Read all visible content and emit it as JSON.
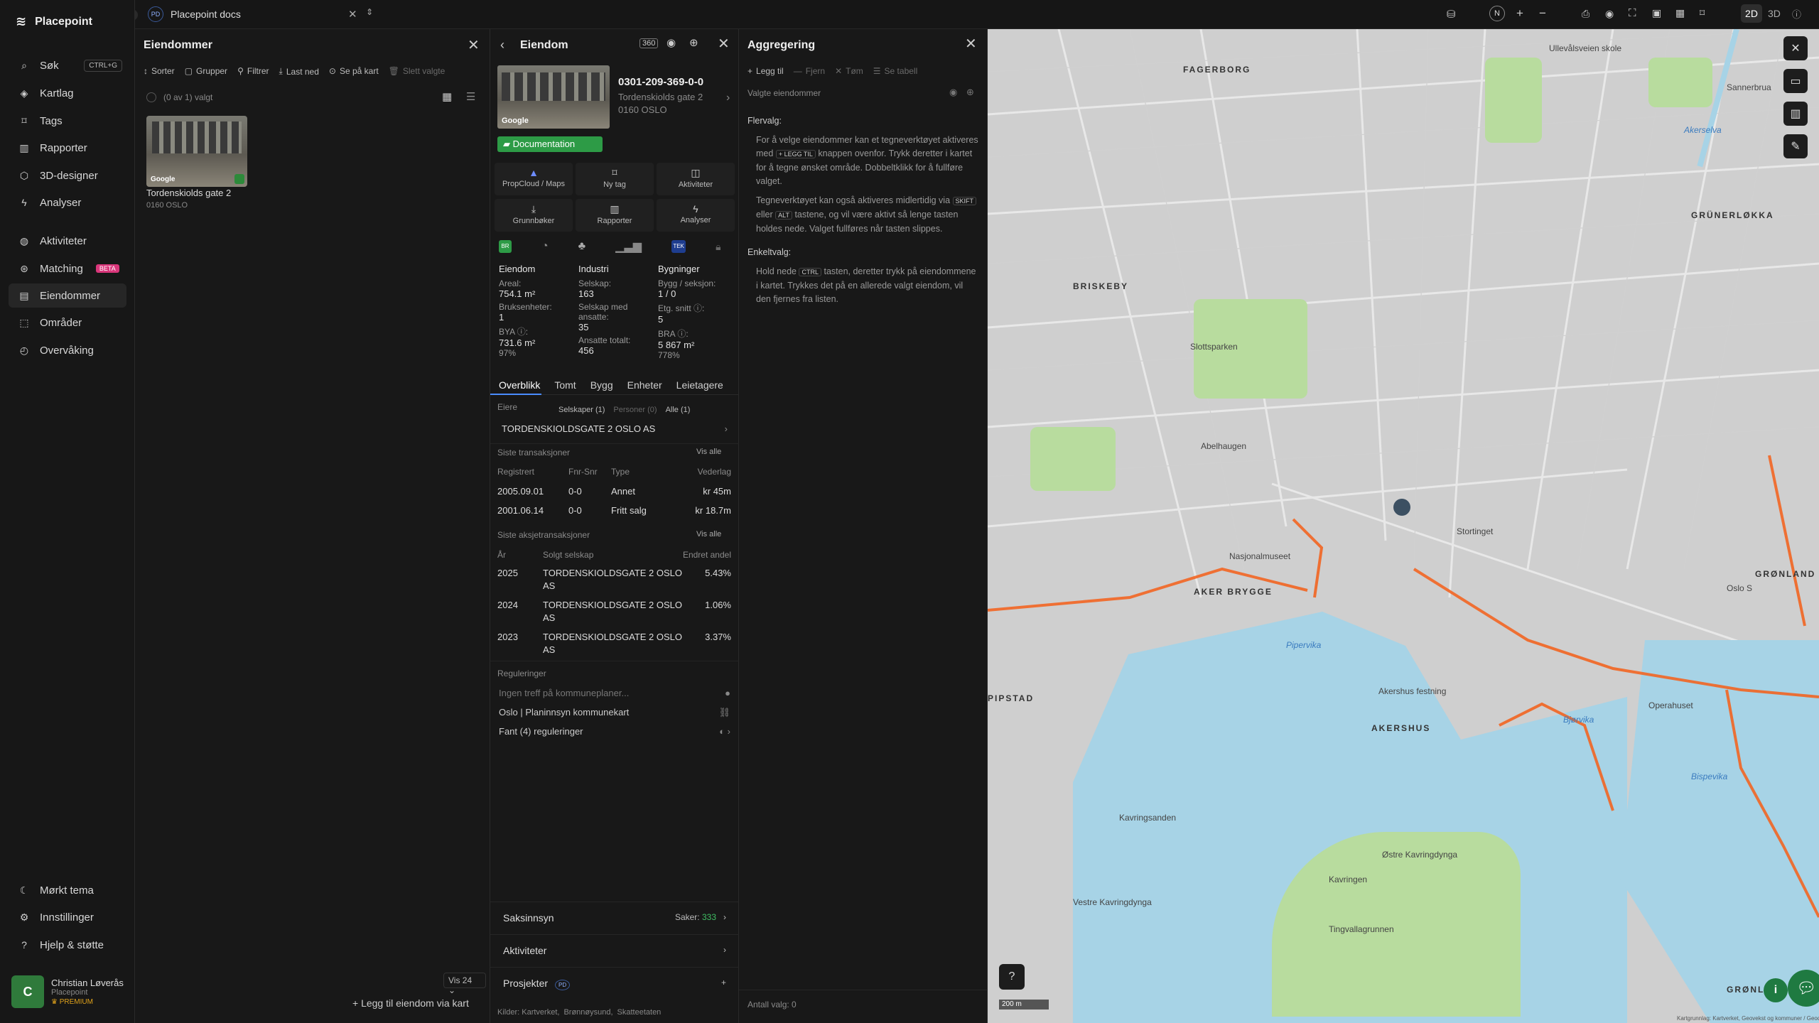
{
  "app": {
    "name": "Placepoint",
    "workspace_badge": "PD",
    "workspace": "Placepoint docs"
  },
  "nav": [
    {
      "label": "Søk",
      "icon": "search-icon",
      "kbd": "CTRL+G"
    },
    {
      "label": "Kartlag",
      "icon": "layers-icon"
    },
    {
      "label": "Tags",
      "icon": "bookmark-icon"
    },
    {
      "label": "Rapporter",
      "icon": "chart-icon"
    },
    {
      "label": "3D-designer",
      "icon": "cube-icon"
    },
    {
      "label": "Analyser",
      "icon": "bolt-icon"
    },
    {
      "label": "Aktiviteter",
      "icon": "activity-icon"
    },
    {
      "label": "Matching",
      "icon": "match-icon",
      "badge": "BETA"
    },
    {
      "label": "Eiendommer",
      "icon": "building-icon"
    },
    {
      "label": "Områder",
      "icon": "area-icon"
    },
    {
      "label": "Overvåking",
      "icon": "monitor-icon"
    }
  ],
  "bottom_nav": [
    {
      "label": "Mørkt tema",
      "icon": "moon-icon"
    },
    {
      "label": "Innstillinger",
      "icon": "gear-icon"
    },
    {
      "label": "Hjelp & støtte",
      "icon": "help-icon"
    }
  ],
  "user": {
    "initial": "C",
    "name": "Christian Løverås",
    "org": "Placepoint",
    "plan": "PREMIUM"
  },
  "topbar": {
    "view2d": "2D",
    "view3d": "3D",
    "north": "N"
  },
  "eiendommer": {
    "title": "Eiendommer",
    "tools": [
      "Sorter",
      "Grupper",
      "Filtrer",
      "Last ned",
      "Se på kart",
      "Slett valgte"
    ],
    "selected": "(0 av 1) valgt",
    "card_title": "Tordenskiolds gate 2",
    "card_sub": "0160 OSLO",
    "google": "Google",
    "vis": "Vis 24",
    "add": "Legg til eiendom via kart"
  },
  "eiendom": {
    "title": "Eiendom",
    "id": "0301-209-369-0-0",
    "addr1": "Tordenskiolds gate 2",
    "addr2": "0160 OSLO",
    "doc": "Documentation",
    "google": "Google",
    "actions": [
      "PropCloud / Maps",
      "Ny tag",
      "Aktiviteter",
      "Grunnbøker",
      "Rapporter",
      "Analyser"
    ],
    "cols": [
      {
        "h": "Eiendom",
        "items": [
          [
            "Areal:",
            "754.1 m²"
          ],
          [
            "Bruksenheter:",
            "1"
          ],
          [
            "BYA ⓘ:",
            "731.6 m²",
            "97%"
          ]
        ]
      },
      {
        "h": "Industri",
        "items": [
          [
            "Selskap:",
            "163"
          ],
          [
            "Selskap med ansatte:",
            "35"
          ],
          [
            "Ansatte totalt:",
            "456"
          ]
        ]
      },
      {
        "h": "Bygninger",
        "items": [
          [
            "Bygg / seksjon:",
            "1 / 0"
          ],
          [
            "Etg. snitt ⓘ:",
            "5"
          ],
          [
            "BRA ⓘ:",
            "5 867 m²",
            "778%"
          ]
        ]
      }
    ],
    "tabs": [
      "Overblikk",
      "Tomt",
      "Bygg",
      "Enheter",
      "Leietagere"
    ],
    "owners_label": "Eiere",
    "owners_filters": [
      "Selskaper (1)",
      "Personer (0)",
      "Alle (1)"
    ],
    "owner": "TORDENSKIOLDSGATE 2 OSLO AS",
    "trans_label": "Siste transaksjoner",
    "vis_alle": "Vis alle",
    "trans_cols": [
      "Registrert",
      "Fnr-Snr",
      "Type",
      "Vederlag"
    ],
    "trans": [
      [
        "2005.09.01",
        "0-0",
        "Annet",
        "kr 45m"
      ],
      [
        "2001.06.14",
        "0-0",
        "Fritt salg",
        "kr 18.7m"
      ]
    ],
    "share_label": "Siste aksjetransaksjoner",
    "share_cols": [
      "År",
      "Solgt selskap",
      "Endret andel"
    ],
    "shares": [
      [
        "2025",
        "TORDENSKIOLDSGATE 2 OSLO AS",
        "5.43%"
      ],
      [
        "2024",
        "TORDENSKIOLDSGATE 2 OSLO AS",
        "1.06%"
      ],
      [
        "2023",
        "TORDENSKIOLDSGATE 2 OSLO AS",
        "3.37%"
      ]
    ],
    "reg_label": "Reguleringer",
    "reg": [
      "Ingen treff på kommuneplaner...",
      "Oslo | Planinnsyn kommunekart",
      "Fant (4) reguleringer"
    ],
    "bottom": [
      {
        "label": "Saksinnsyn",
        "extra": "Saker:",
        "count": "333"
      },
      {
        "label": "Aktiviteter"
      },
      {
        "label": "Prosjekter",
        "badge": "PD"
      }
    ],
    "sources_label": "Kilder:",
    "sources": [
      "Kartverket,",
      "Brønnøysund,",
      "Skatteetaten"
    ]
  },
  "aggregering": {
    "title": "Aggregering",
    "tools": [
      "Legg til",
      "Fjern",
      "Tøm",
      "Se tabell"
    ],
    "sel": "Valgte eiendommer",
    "h1": "Flervalg:",
    "p1": "For å velge eiendommer kan et tegneverktøyet aktiveres med",
    "p1k": "+ LEGG TIL",
    "p1b": "knappen ovenfor. Trykk deretter i kartet for å tegne ønsket område. Dobbeltklikk for å fullføre valget.",
    "p2": "Tegneverktøyet kan også aktiveres midlertidig via",
    "p2k1": "SKIFT",
    "p2m": "eller",
    "p2k2": "ALT",
    "p2b": "tastene, og vil være aktivt så lenge tasten holdes nede. Valget fullføres når tasten slippes.",
    "h2": "Enkeltvalg:",
    "p3": "Hold nede",
    "p3k": "CTRL",
    "p3b": "tasten, deretter trykk på eiendommene i kartet. Trykkes det på en allerede valgt eiendom, vil den fjernes fra listen.",
    "count": "Antall valg: 0"
  },
  "map": {
    "labels": [
      "FAGERBORG",
      "BRISKEBY",
      "GRÜNERLØKKA",
      "AKER BRYGGE",
      "AKERSHUS",
      "GRØNLAND",
      "PIPSTAD",
      "GRØNLIA",
      "Akerselva",
      "Pipervika",
      "Bjørvika",
      "Kavringen",
      "Østre Kavringdynga",
      "Vestre Kavringdynga",
      "Tingvallagrunnen",
      "Kavringsanden",
      "Bispevika",
      "Sannerbrua",
      "Nasjonalmuseet",
      "Slottsparken",
      "Oslo S",
      "Ullevålsveien skole",
      "Akershus festning",
      "Operahuset",
      "Abelhaugen",
      "Stortinget"
    ],
    "scale": "200 m",
    "attrib": "Kartgrunnlag: Kartverket, Geovekst og kommuner / Geodata AS, Powered by Esri"
  }
}
